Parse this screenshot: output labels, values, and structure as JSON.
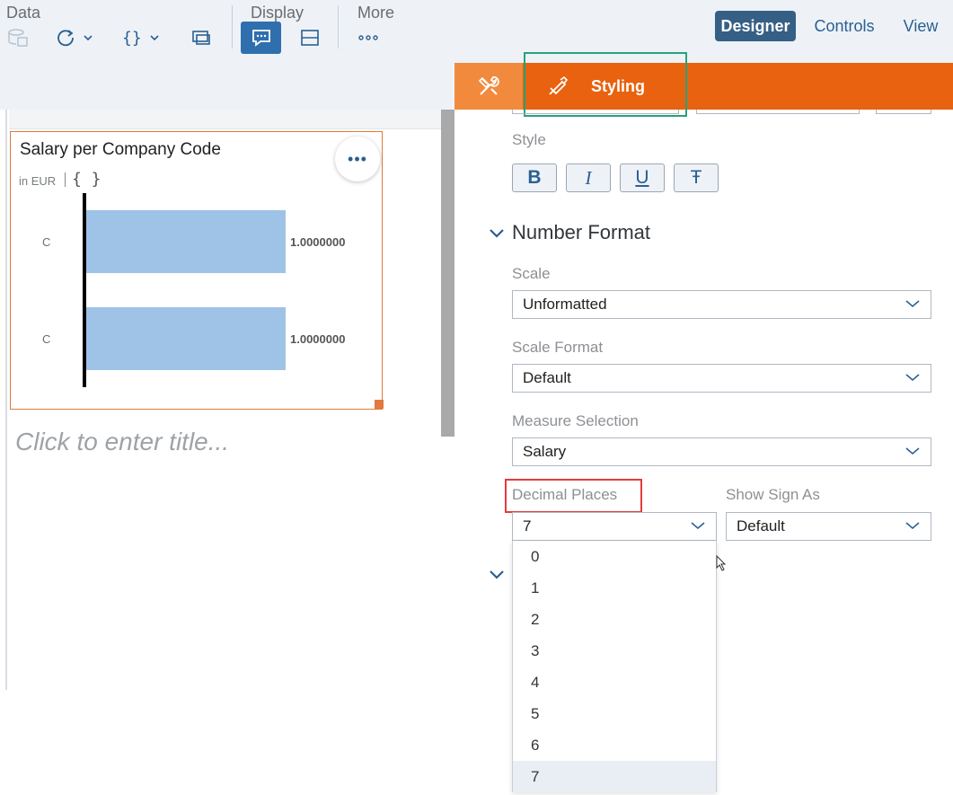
{
  "toolbar": {
    "groups": {
      "data": "Data",
      "display": "Display",
      "more": "More"
    },
    "modes": {
      "designer": "Designer",
      "controls": "Controls",
      "view": "View"
    },
    "icons": [
      "data-source-icon",
      "refresh-icon",
      "formula-icon",
      "duplicate-icon",
      "comment-icon",
      "layout-icon",
      "more-dots-icon"
    ]
  },
  "widget": {
    "title": "Salary per Company Code",
    "subtitle": "in EUR",
    "brace": "{ }",
    "more": "•••",
    "click_title": "Click to enter title..."
  },
  "chart_data": {
    "type": "bar",
    "orientation": "horizontal",
    "categories": [
      "C",
      "C"
    ],
    "values": [
      1.0,
      1.0
    ],
    "data_labels": [
      "1.0000000",
      "1.0000000"
    ],
    "color": "#9fc3e7"
  },
  "panel": {
    "tab_active": "Styling",
    "style_label": "Style",
    "format_buttons": [
      "B",
      "I",
      "U",
      "Ŧ"
    ],
    "number_format_title": "Number Format",
    "scale_label": "Scale",
    "scale_value": "Unformatted",
    "scale_format_label": "Scale Format",
    "scale_format_value": "Default",
    "measure_label": "Measure Selection",
    "measure_value": "Salary",
    "decimal_label": "Decimal Places",
    "decimal_value": "7",
    "sign_label": "Show Sign As",
    "sign_value": "Default",
    "decimal_options": [
      "0",
      "1",
      "2",
      "3",
      "4",
      "5",
      "6",
      "7"
    ]
  },
  "colors": {
    "accent_orange": "#e8620f",
    "tab_orange_light": "#f28a3e",
    "designer_bg": "#355f85",
    "highlight_green": "#27a27a",
    "highlight_red": "#e53b3b",
    "bar": "#9fc3e7"
  }
}
